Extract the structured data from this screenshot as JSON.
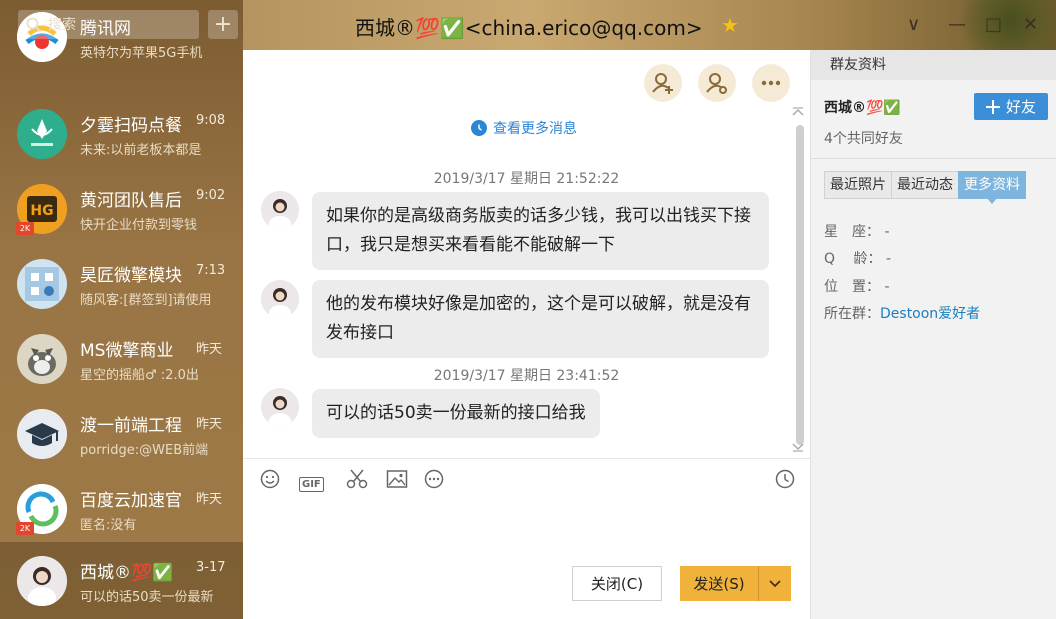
{
  "search": {
    "placeholder": "搜索"
  },
  "sidebar_add": "+",
  "conversations": [
    {
      "name": "腾讯网",
      "time": "",
      "preview": "英特尔为苹果5G手机"
    },
    {
      "name": "夕霎扫码点餐",
      "time": "9:08",
      "preview": "未来:以前老板本都是"
    },
    {
      "name": "黄河团队售后",
      "time": "9:02",
      "preview": "快开企业付款到零钱"
    },
    {
      "name": "昊匠微擎模块",
      "time": "7:13",
      "preview": "随风客:[群签到]请使用"
    },
    {
      "name": "MS微擎商业",
      "time": "昨天",
      "preview": "星空的摇船♂ :2.0出"
    },
    {
      "name": "渡一前端工程",
      "time": "昨天",
      "preview": "porridge:@WEB前端"
    },
    {
      "name": "百度云加速官",
      "time": "昨天",
      "preview": "匿名:没有"
    },
    {
      "name": "西城®💯✅",
      "time": "3-17",
      "preview": "可以的话50卖一份最新"
    }
  ],
  "badge_2k": "2K",
  "window": {
    "title": "西城®💯✅<china.erico@qq.com>",
    "star": "★",
    "ctrl_dropdown": "∨",
    "ctrl_minimize": "—",
    "ctrl_maximize": "□",
    "ctrl_close": "✕"
  },
  "chat": {
    "more_messages": "查看更多消息",
    "messages": [
      {
        "timestamp": "2019/3/17 星期日 21:52:22",
        "text": "如果你的是高级商务版卖的话多少钱，我可以出钱买下接口，我只是想买来看看能不能破解一下"
      },
      {
        "timestamp": "",
        "text": "他的发布模块好像是加密的，这个是可以破解，就是没有发布接口"
      },
      {
        "timestamp": "2019/3/17 星期日 23:41:52",
        "text": "可以的话50卖一份最新的接口给我"
      }
    ],
    "tools": {
      "gif_label": "GIF"
    },
    "close_label": "关闭(C)",
    "send_label": "发送(S)"
  },
  "panel": {
    "header": "群友资料",
    "name": "西城®💯✅",
    "add_friend": "好友",
    "mutual_friends": "4个共同好友",
    "tabs": [
      "最近照片",
      "最近动态",
      "更多资料"
    ],
    "active_tab": "更多资料",
    "fields": [
      {
        "label": "星　座：",
        "value": "-"
      },
      {
        "label": "Q　 龄：",
        "value": "-"
      },
      {
        "label": "位　置：",
        "value": "-"
      }
    ],
    "group_label": "所在群：",
    "group_value": "Destoon爱好者"
  },
  "colors": {
    "sidebar": "#8e6a3a",
    "accent_blue": "#3b8fd9",
    "send_button": "#f0b23a",
    "link": "#2b86d4"
  }
}
